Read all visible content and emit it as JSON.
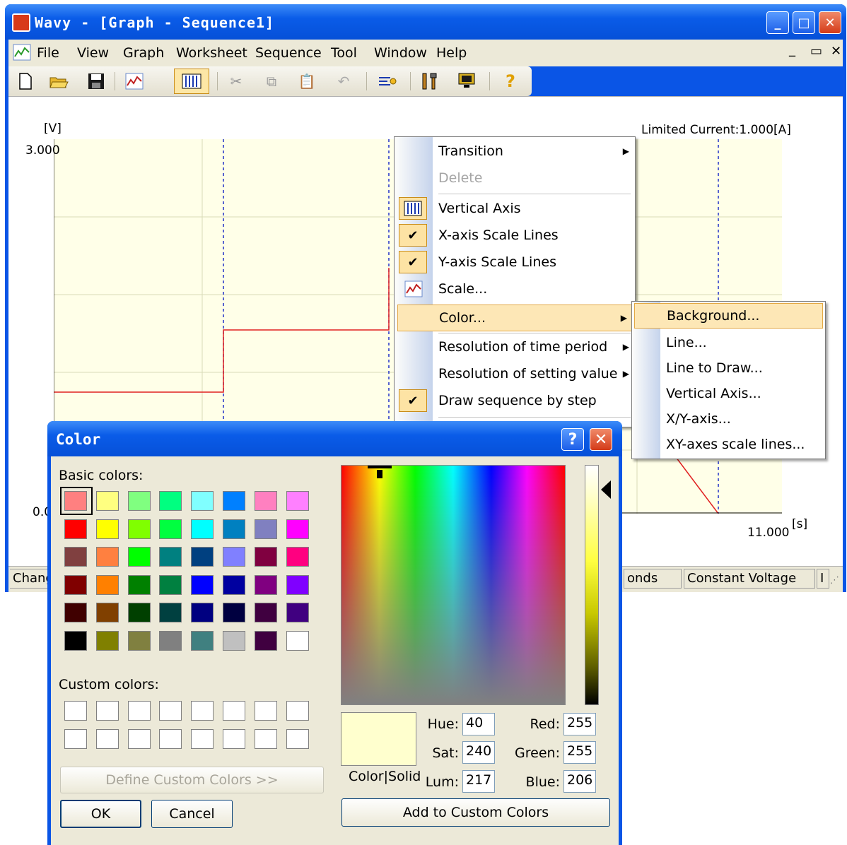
{
  "window": {
    "title": "Wavy - [Graph - Sequence1]",
    "controls": {
      "minimize": "_",
      "maximize": "□",
      "close": "✕"
    }
  },
  "menubar": {
    "items": [
      "File",
      "View",
      "Graph",
      "Worksheet",
      "Sequence",
      "Tool",
      "Window",
      "Help"
    ],
    "doc_controls": {
      "minimize": "_",
      "restore": "▭",
      "close": "✕"
    }
  },
  "toolbar": {
    "icons": [
      "new-document-icon",
      "open-folder-icon",
      "save-icon",
      "graph-icon",
      "vertical-axis-icon",
      "cut-icon",
      "copy-icon",
      "paste-icon",
      "undo-icon",
      "settings-icon",
      "tools-icon",
      "monitor-icon",
      "help-icon"
    ]
  },
  "graph": {
    "y_unit": "[V]",
    "y_top_label": "3.000",
    "y_bottom_label": "0.0",
    "x_unit": "[s]",
    "x_right_label": "11.000",
    "limited_current": "Limited Current:1.000[A]",
    "background_color": "#ffffe8",
    "line_color": "#e02020"
  },
  "statusbar": {
    "left": "Chang",
    "mid": "onds",
    "mode": "Constant Voltage",
    "right": "I"
  },
  "context_menu": {
    "items": {
      "transition": "Transition",
      "delete": "Delete",
      "vertical_axis": "Vertical Axis",
      "x_scale": "X-axis Scale Lines",
      "y_scale": "Y-axis Scale Lines",
      "scale": "Scale...",
      "color": "Color...",
      "res_time": "Resolution of time period",
      "res_value": "Resolution of setting value",
      "draw_step": "Draw sequence by step"
    },
    "check": "✔"
  },
  "color_submenu": {
    "items": [
      "Background...",
      "Line...",
      "Line to Draw...",
      "Vertical Axis...",
      "X/Y-axis...",
      "XY-axes scale lines..."
    ]
  },
  "color_dialog": {
    "title": "Color",
    "help_btn": "?",
    "close_btn": "✕",
    "basic_label": "Basic colors:",
    "custom_label": "Custom colors:",
    "define_btn": "Define Custom Colors >>",
    "ok": "OK",
    "cancel": "Cancel",
    "add_btn": "Add to Custom Colors",
    "color_solid": "Color|Solid",
    "hue_label": "Hue:",
    "hue": "40",
    "sat_label": "Sat:",
    "sat": "240",
    "lum_label": "Lum:",
    "lum": "217",
    "red_label": "Red:",
    "red": "255",
    "green_label": "Green:",
    "green": "255",
    "blue_label": "Blue:",
    "blue": "206",
    "selected_color": "#ffffce",
    "basic_colors": [
      "#ff8080",
      "#ffff80",
      "#80ff80",
      "#00ff80",
      "#80ffff",
      "#0080ff",
      "#ff80c0",
      "#ff80ff",
      "#ff0000",
      "#ffff00",
      "#80ff00",
      "#00ff40",
      "#00ffff",
      "#0080c0",
      "#8080c0",
      "#ff00ff",
      "#804040",
      "#ff8040",
      "#00ff00",
      "#008080",
      "#004080",
      "#8080ff",
      "#800040",
      "#ff0080",
      "#800000",
      "#ff8000",
      "#008000",
      "#008040",
      "#0000ff",
      "#0000a0",
      "#800080",
      "#8000ff",
      "#400000",
      "#804000",
      "#004000",
      "#004040",
      "#000080",
      "#000040",
      "#400040",
      "#400080",
      "#000000",
      "#808000",
      "#808040",
      "#808080",
      "#408080",
      "#c0c0c0",
      "#400040",
      "#ffffff"
    ]
  }
}
